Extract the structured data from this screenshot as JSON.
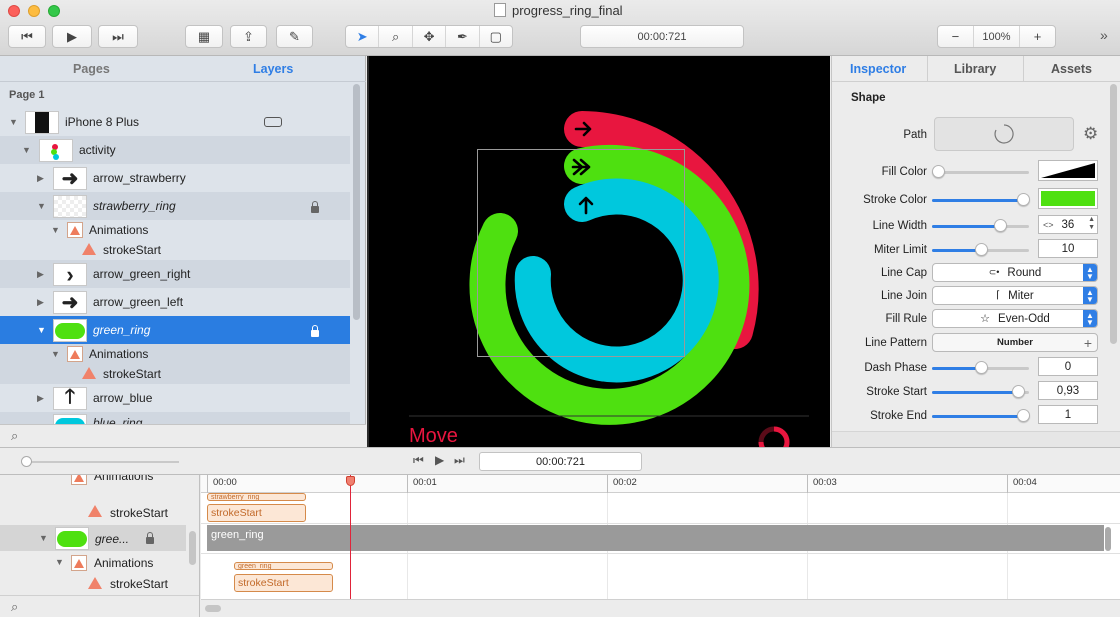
{
  "window": {
    "title": "progress_ring_final",
    "timecode": "00:00:721",
    "zoom": "100%"
  },
  "left_panel": {
    "tabs": [
      "Pages",
      "Layers"
    ],
    "page_label": "Page 1",
    "layers": [
      {
        "name": "iPhone 8 Plus"
      },
      {
        "name": "activity"
      },
      {
        "name": "arrow_strawberry"
      },
      {
        "name": "strawberry_ring"
      },
      {
        "name": "Animations"
      },
      {
        "name": "strokeStart"
      },
      {
        "name": "arrow_green_right"
      },
      {
        "name": "arrow_green_left"
      },
      {
        "name": "green_ring"
      },
      {
        "name": "Animations"
      },
      {
        "name": "strokeStart"
      },
      {
        "name": "arrow_blue"
      },
      {
        "name": "blue_ring"
      }
    ]
  },
  "canvas": {
    "move_label": "Move",
    "ring_colors": {
      "red": "#e8163f",
      "green": "#4ee010",
      "blue": "#00c8dd"
    }
  },
  "inspector": {
    "tabs": [
      "Inspector",
      "Library",
      "Assets"
    ],
    "section_title": "Shape",
    "path_label": "Path",
    "fill_color_label": "Fill Color",
    "stroke_color_label": "Stroke Color",
    "stroke_color": "#4ee010",
    "line_width_label": "Line Width",
    "line_width": "36",
    "miter_limit_label": "Miter Limit",
    "miter_limit": "10",
    "line_cap_label": "Line Cap",
    "line_cap": "Round",
    "line_join_label": "Line Join",
    "line_join": "Miter",
    "fill_rule_label": "Fill Rule",
    "fill_rule": "Even-Odd",
    "line_pattern_label": "Line Pattern",
    "line_pattern": "Number",
    "dash_phase_label": "Dash Phase",
    "dash_phase": "0",
    "stroke_start_label": "Stroke Start",
    "stroke_start": "0,93",
    "stroke_end_label": "Stroke End",
    "stroke_end": "1"
  },
  "timeline": {
    "timecode": "00:00:721",
    "ruler": [
      "00:00",
      "00:01",
      "00:02",
      "00:03",
      "00:04"
    ],
    "rows": [
      {
        "name": "Animations"
      },
      {
        "name": "strokeStart"
      },
      {
        "name": "gree..."
      },
      {
        "name": "Animations"
      },
      {
        "name": "strokeStart"
      }
    ],
    "clips": {
      "strawberry_small": "strawberry_ring",
      "strawberry_stroke": "strokeStart",
      "green_bar": "green_ring",
      "green_small": "green_ring",
      "green_stroke": "strokeStart"
    }
  }
}
